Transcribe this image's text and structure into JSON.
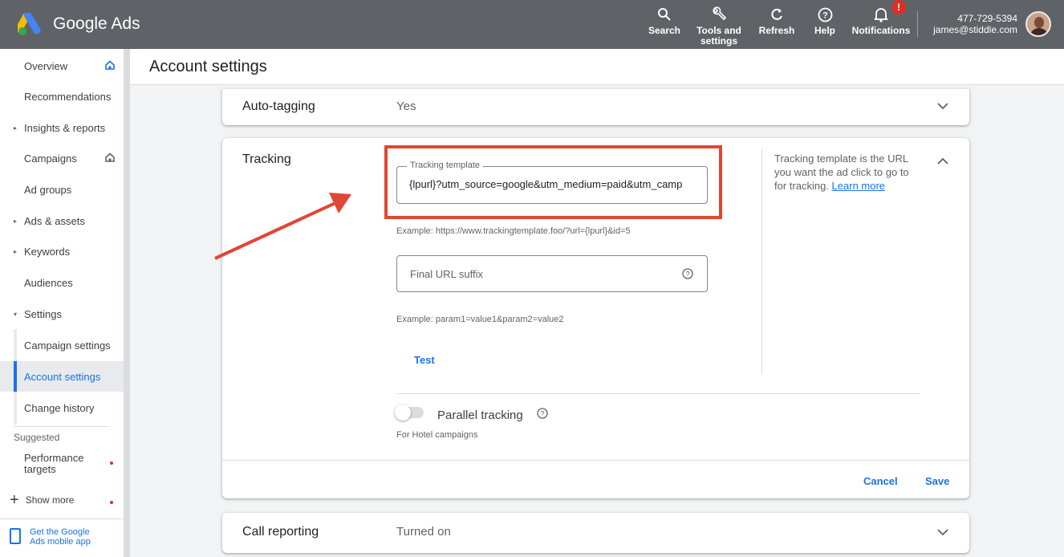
{
  "app": {
    "brand": "Google Ads"
  },
  "topbar": {
    "search": "Search",
    "tools_line1": "Tools and",
    "tools_line2": "settings",
    "refresh": "Refresh",
    "help": "Help",
    "notifications": "Notifications",
    "notif_badge": "!",
    "account_id": "477-729-5394",
    "account_email": "james@stiddle.com"
  },
  "sidebar": {
    "items": [
      {
        "label": "Overview",
        "icon": "home-icon"
      },
      {
        "label": "Recommendations"
      },
      {
        "label": "Insights & reports",
        "caret": "▸"
      },
      {
        "label": "Campaigns",
        "icon": "home-icon"
      },
      {
        "label": "Ad groups"
      },
      {
        "label": "Ads & assets",
        "caret": "▸"
      },
      {
        "label": "Keywords",
        "caret": "▸"
      },
      {
        "label": "Audiences"
      },
      {
        "label": "Settings",
        "caret": "▾"
      },
      {
        "label": "Campaign settings"
      },
      {
        "label": "Account settings",
        "active": true
      },
      {
        "label": "Change history"
      }
    ],
    "suggested": "Suggested",
    "performance_line1": "Performance",
    "performance_line2": "targets",
    "show_more": "Show more",
    "mobile_line1": "Get the Google",
    "mobile_line2": "Ads mobile app"
  },
  "page": {
    "title": "Account settings"
  },
  "auto_tagging": {
    "label": "Auto-tagging",
    "value": "Yes"
  },
  "tracking": {
    "label": "Tracking",
    "template_label": "Tracking template",
    "template_value": "{lpurl}?utm_source=google&utm_medium=paid&utm_camp",
    "template_example": "Example: https://www.trackingtemplate.foo/?url={lpurl}&id=5",
    "suffix_placeholder": "Final URL suffix",
    "suffix_example": "Example: param1=value1&param2=value2",
    "test": "Test",
    "help_text": "Tracking template is the URL you want the ad click to go to for tracking.",
    "learn_more": "Learn more",
    "parallel_label": "Parallel tracking",
    "parallel_on": false,
    "parallel_note": "For Hotel campaigns",
    "cancel": "Cancel",
    "save": "Save"
  },
  "call_reporting": {
    "label": "Call reporting",
    "value": "Turned on"
  },
  "colors": {
    "topbar": "#5f6368",
    "accent": "#1a73e8",
    "highlight": "#e04634",
    "alert": "#d93025"
  }
}
